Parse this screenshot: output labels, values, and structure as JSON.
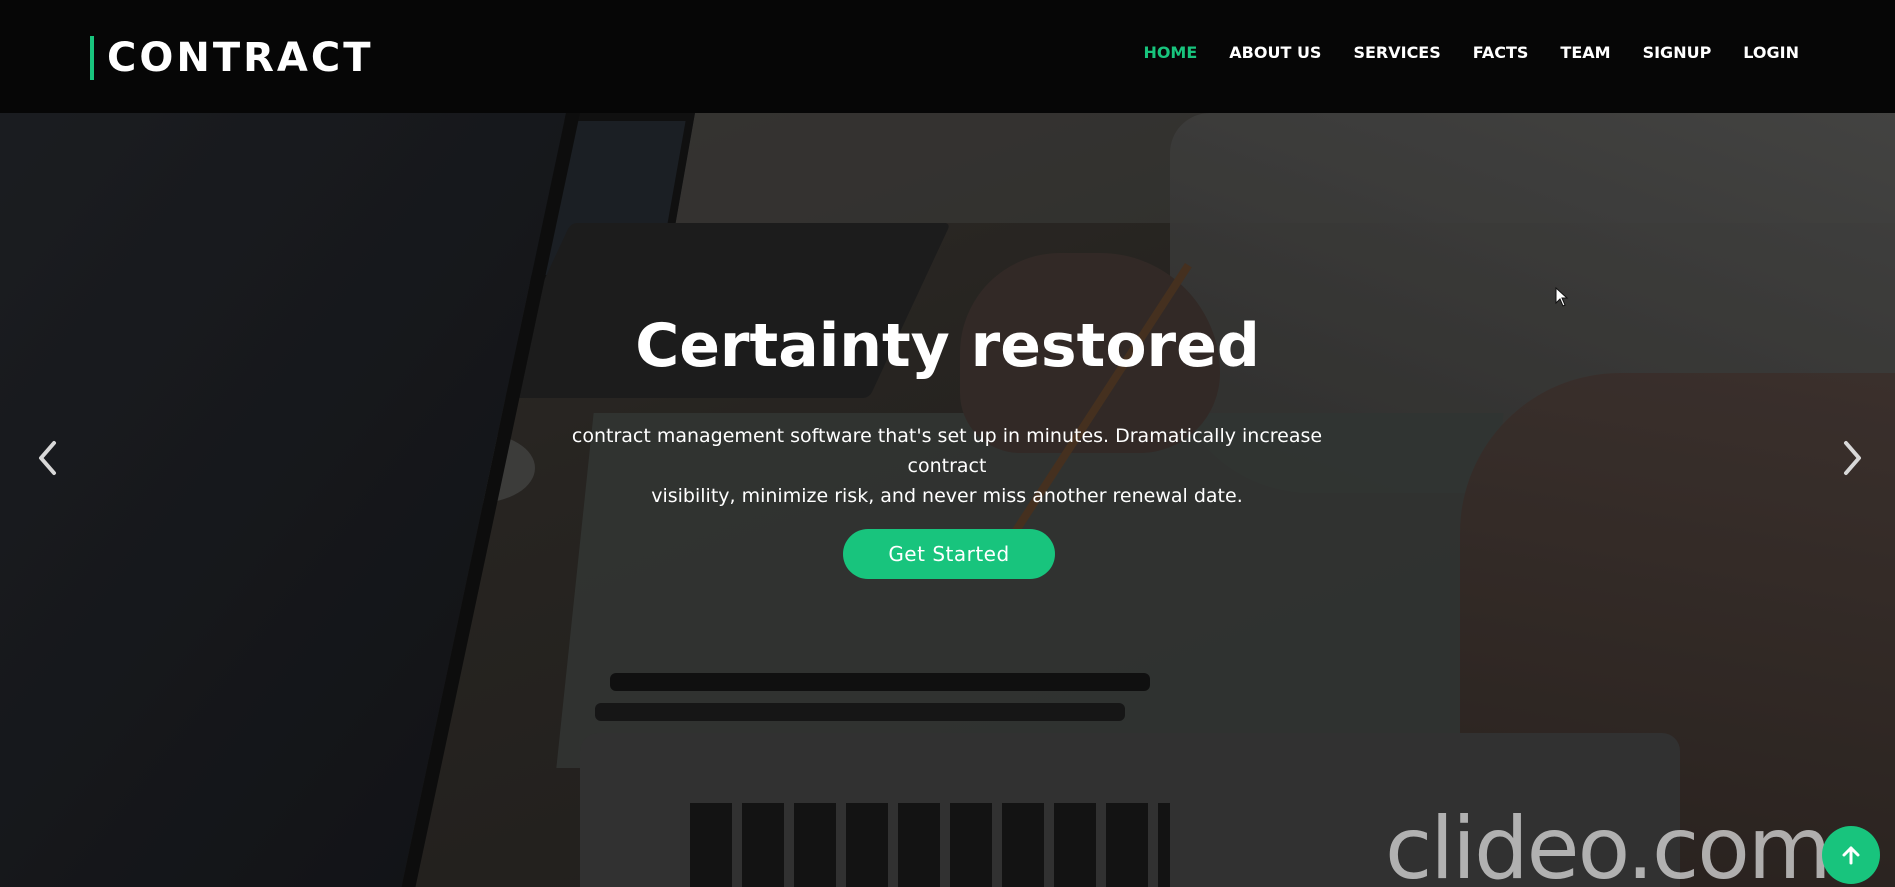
{
  "brand": {
    "name": "CONTRACT",
    "accent": "#18c47d"
  },
  "nav": {
    "items": [
      {
        "label": "HOME",
        "active": true
      },
      {
        "label": "ABOUT US"
      },
      {
        "label": "SERVICES"
      },
      {
        "label": "FACTS"
      },
      {
        "label": "TEAM"
      },
      {
        "label": "SIGNUP"
      },
      {
        "label": "LOGIN"
      }
    ]
  },
  "hero": {
    "title": "Certainty restored",
    "subtitle_line1": "contract management software that's set up in minutes. Dramatically increase contract",
    "subtitle_line2": "visibility, minimize risk, and never miss another renewal date.",
    "cta_label": "Get Started"
  },
  "carousel": {
    "prev_icon": "chevron-left-icon",
    "next_icon": "chevron-right-icon"
  },
  "watermark": "clideo.com",
  "scroll_top": {
    "icon": "arrow-up-icon"
  }
}
